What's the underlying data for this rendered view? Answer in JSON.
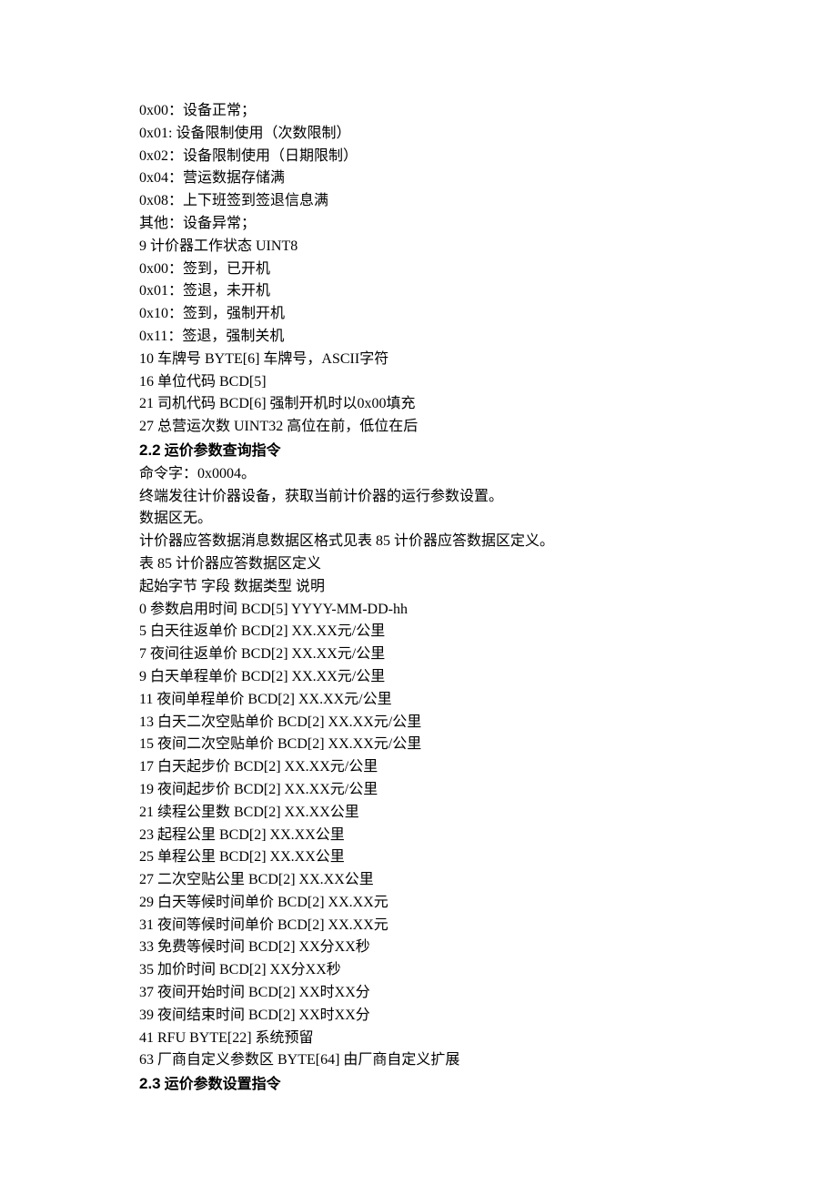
{
  "lines": [
    {
      "t": "0x00：设备正常；"
    },
    {
      "t": "0x01: 设备限制使用（次数限制）"
    },
    {
      "t": "0x02：设备限制使用（日期限制）"
    },
    {
      "t": "0x04：营运数据存储满"
    },
    {
      "t": "0x08：上下班签到签退信息满"
    },
    {
      "t": "其他：设备异常；"
    },
    {
      "t": "9 计价器工作状态 UINT8"
    },
    {
      "t": "0x00：签到，已开机"
    },
    {
      "t": "0x01：签退，未开机"
    },
    {
      "t": "0x10：签到，强制开机"
    },
    {
      "t": "0x11：签退，强制关机"
    },
    {
      "t": "10 车牌号 BYTE[6] 车牌号，ASCII字符"
    },
    {
      "t": "16 单位代码 BCD[5]"
    },
    {
      "t": "21 司机代码 BCD[6] 强制开机时以0x00填充"
    },
    {
      "t": "27 总营运次数 UINT32 高位在前，低位在后"
    },
    {
      "type": "heading",
      "num": "2.2",
      "title": "运价参数查询指令"
    },
    {
      "t": "命令字：0x0004。"
    },
    {
      "t": "终端发往计价器设备，获取当前计价器的运行参数设置。"
    },
    {
      "t": "数据区无。"
    },
    {
      "t": "计价器应答数据消息数据区格式见表 85 计价器应答数据区定义。"
    },
    {
      "t": "表 85 计价器应答数据区定义"
    },
    {
      "t": "起始字节 字段 数据类型 说明"
    },
    {
      "t": "0 参数启用时间 BCD[5] YYYY-MM-DD-hh"
    },
    {
      "t": "5 白天往返单价 BCD[2] XX.XX元/公里"
    },
    {
      "t": "7 夜间往返单价 BCD[2] XX.XX元/公里"
    },
    {
      "t": "9 白天单程单价 BCD[2] XX.XX元/公里"
    },
    {
      "t": "11 夜间单程单价 BCD[2] XX.XX元/公里"
    },
    {
      "t": "13 白天二次空贴单价 BCD[2] XX.XX元/公里"
    },
    {
      "t": "15 夜间二次空贴单价 BCD[2] XX.XX元/公里"
    },
    {
      "t": "17 白天起步价 BCD[2] XX.XX元/公里"
    },
    {
      "t": "19 夜间起步价 BCD[2] XX.XX元/公里"
    },
    {
      "t": "21 续程公里数 BCD[2] XX.XX公里"
    },
    {
      "t": "23 起程公里 BCD[2] XX.XX公里"
    },
    {
      "t": "25 单程公里 BCD[2] XX.XX公里"
    },
    {
      "t": "27 二次空贴公里 BCD[2] XX.XX公里"
    },
    {
      "t": "29 白天等候时间单价 BCD[2] XX.XX元"
    },
    {
      "t": "31 夜间等候时间单价 BCD[2] XX.XX元"
    },
    {
      "t": "33 免费等候时间 BCD[2] XX分XX秒"
    },
    {
      "t": "35 加价时间 BCD[2] XX分XX秒"
    },
    {
      "t": "37 夜间开始时间 BCD[2] XX时XX分"
    },
    {
      "t": "39 夜间结束时间 BCD[2] XX时XX分"
    },
    {
      "t": "41 RFU BYTE[22] 系统预留"
    },
    {
      "t": "63 厂商自定义参数区 BYTE[64] 由厂商自定义扩展"
    },
    {
      "type": "heading",
      "num": "2.3",
      "title": "运价参数设置指令"
    }
  ]
}
